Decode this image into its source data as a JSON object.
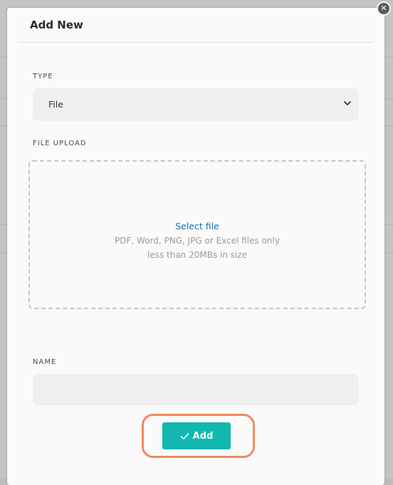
{
  "modal": {
    "title": "Add New",
    "close_icon": "close-icon"
  },
  "type_field": {
    "label": "TYPE",
    "value": "File",
    "icon": "chevron-down-icon"
  },
  "upload_field": {
    "label": "FILE UPLOAD",
    "select_label": "Select file",
    "hint_line1": "PDF, Word, PNG, JPG or Excel files only",
    "hint_line2": "less than 20MBs in size"
  },
  "name_field": {
    "label": "NAME",
    "value": ""
  },
  "add_button": {
    "label": "Add",
    "icon": "check-icon",
    "color": "#12b8b0",
    "highlight_color": "#ef8a5c"
  }
}
